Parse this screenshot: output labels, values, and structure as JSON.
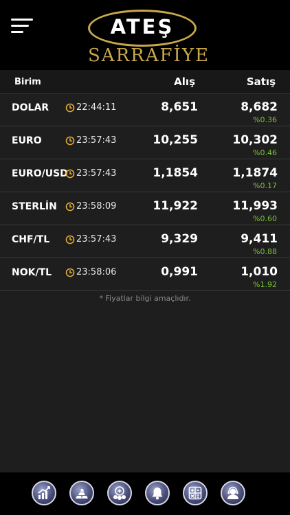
{
  "header": {
    "logo_mark": "ATEŞ",
    "logo_sub": "SARRAFİYE"
  },
  "table": {
    "headers": {
      "unit": "Birim",
      "buy": "Alış",
      "sell": "Satış"
    },
    "rows": [
      {
        "name": "DOLAR",
        "time": "22:44:11",
        "buy": "8,651",
        "sell": "8,682",
        "change": "%0.36"
      },
      {
        "name": "EURO",
        "time": "23:57:43",
        "buy": "10,255",
        "sell": "10,302",
        "change": "%0.46"
      },
      {
        "name": "EURO/USD",
        "time": "23:57:43",
        "buy": "1,1854",
        "sell": "1,1874",
        "change": "%0.17"
      },
      {
        "name": "STERLİN",
        "time": "23:58:09",
        "buy": "11,922",
        "sell": "11,993",
        "change": "%0.60"
      },
      {
        "name": "CHF/TL",
        "time": "23:57:43",
        "buy": "9,329",
        "sell": "9,411",
        "change": "%0.88"
      },
      {
        "name": "NOK/TL",
        "time": "23:58:06",
        "buy": "0,991",
        "sell": "1,010",
        "change": "%1.92"
      }
    ]
  },
  "note": "* Fiyatlar bilgi amaçlıdır.",
  "tabs": [
    {
      "icon": "chart-icon"
    },
    {
      "icon": "gold-bars-icon"
    },
    {
      "icon": "coins-icon"
    },
    {
      "icon": "bell-icon"
    },
    {
      "icon": "calculator-icon"
    },
    {
      "icon": "support-icon"
    }
  ],
  "colors": {
    "gold": "#c9a84b",
    "positive": "#7cc33a",
    "clock": "#e0a83a"
  }
}
